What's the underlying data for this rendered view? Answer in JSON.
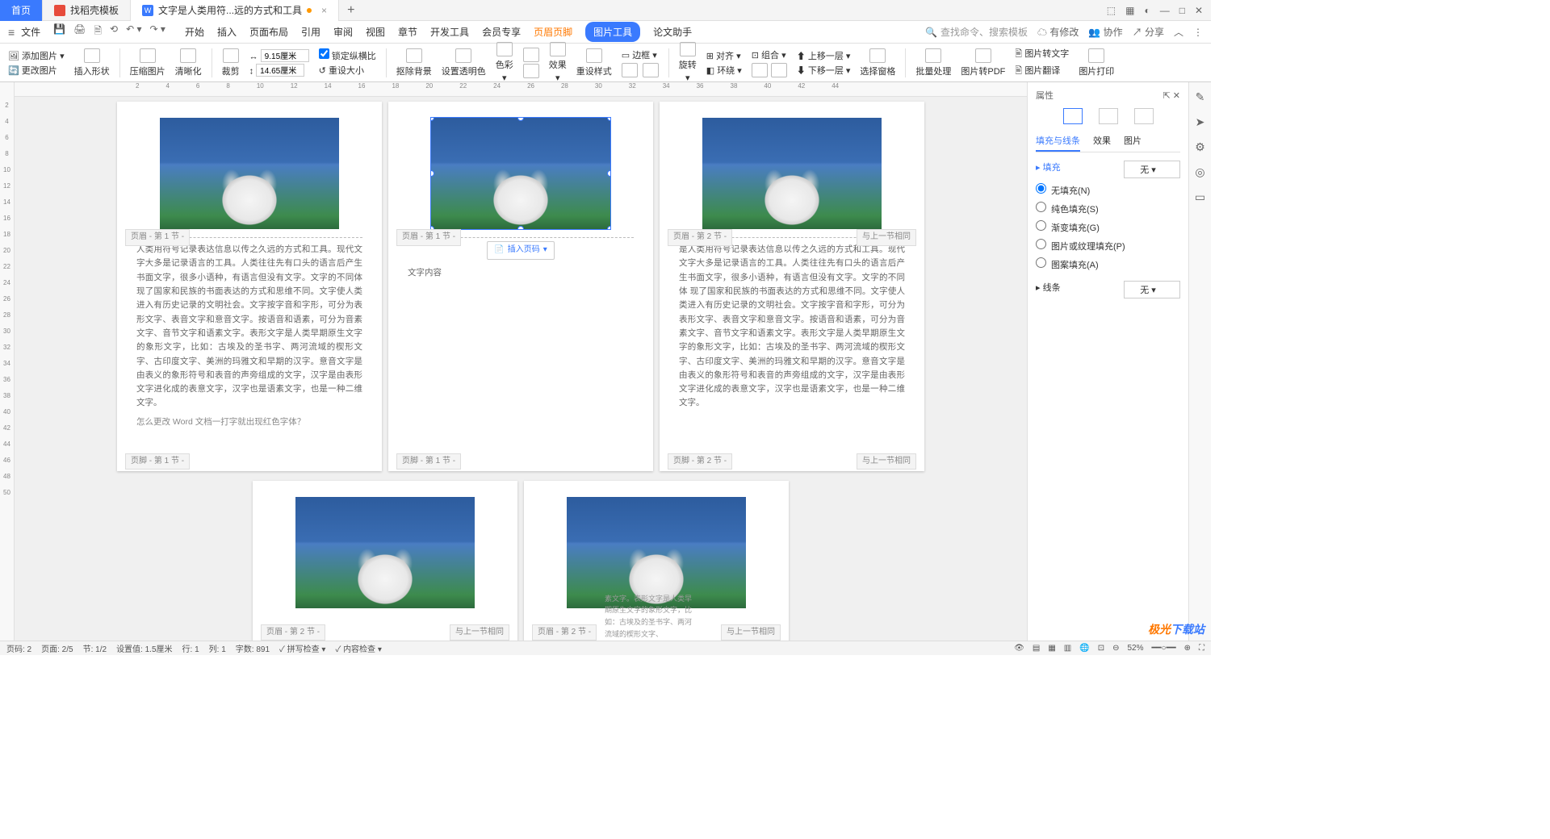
{
  "titlebar": {
    "tabs": [
      {
        "label": "首页"
      },
      {
        "label": "找稻壳模板"
      },
      {
        "label": "文字是人类用符...远的方式和工具"
      }
    ],
    "add": "+",
    "close": "×"
  },
  "menubar": {
    "file": "文件",
    "tabs": [
      "开始",
      "插入",
      "页面布局",
      "引用",
      "审阅",
      "视图",
      "章节",
      "开发工具",
      "会员专享",
      "页眉页脚",
      "图片工具",
      "论文助手"
    ],
    "search_hint": "查找命令、搜索模板",
    "right": {
      "changes": "有修改",
      "collab": "协作",
      "share": "分享"
    }
  },
  "ribbon": {
    "add_pic": "添加图片",
    "change_pic": "更改图片",
    "insert_shape": "插入形状",
    "compress": "压缩图片",
    "sharpen": "清晰化",
    "crop": "裁剪",
    "w": "9.15厘米",
    "h": "14.65厘米",
    "lock": "锁定纵横比",
    "reset": "重设大小",
    "remove_bg": "抠除背景",
    "transparency": "设置透明色",
    "color": "色彩",
    "effect": "效果",
    "reset_style": "重设样式",
    "border": "边框",
    "rotate": "旋转",
    "align": "对齐",
    "wrap": "环绕",
    "group": "组合",
    "up": "上移一层",
    "down": "下移一层",
    "sel_pane": "选择窗格",
    "batch": "批量处理",
    "to_pdf": "图片转PDF",
    "to_text": "图片转文字",
    "translate": "图片翻译",
    "print": "图片打印"
  },
  "ruler_v": [
    "2",
    "4",
    "6",
    "8",
    "10",
    "12",
    "14",
    "16",
    "18",
    "20",
    "22",
    "24",
    "26",
    "28",
    "30",
    "32",
    "34",
    "36",
    "38",
    "40",
    "42",
    "44",
    "46",
    "48",
    "50"
  ],
  "ruler_h": [
    "2",
    "4",
    "6",
    "8",
    "10",
    "12",
    "14",
    "16",
    "18",
    "20",
    "22",
    "24",
    "26",
    "28",
    "30",
    "32",
    "34",
    "36",
    "38",
    "40",
    "42",
    "44"
  ],
  "pages": {
    "p1": {
      "hdr": "页眉 - 第 1 节 -",
      "ftr": "页脚 - 第 1 节 -",
      "body": "人类用符号记录表达信息以传之久远的方式和工具。现代文字大多是记录语言的工具。人类往往先有口头的语言后产生书面文字，很多小语种，有语言但没有文字。文字的不同体 现了国家和民族的书面表达的方式和思维不同。文字使人类进入有历史记录的文明社会。文字按字音和字形，可分为表形文字、表音文字和意音文字。按语音和语素，可分为音素文字、音节文字和语素文字。表形文字是人类早期原生文字的象形文字，比如：古埃及的圣书字、两河流域的楔形文字、古印度文字、美洲的玛雅文和早期的汉字。意音文字是由表义的象形符号和表音的声旁组成的文字，汉字是由表形文字进化成的表意文字，汉字也是语素文字，也是一种二维文字。",
      "note": "怎么更改 Word 文档一打字就出现红色字体？"
    },
    "p2": {
      "hdr": "页眉 - 第 1 节 -",
      "ftr": "页脚 - 第 1 节 -",
      "insert": "插入页码",
      "body": "文字内容"
    },
    "p3": {
      "hdr": "页眉 - 第 2 节 -",
      "hdr_r": "与上一节相同",
      "ftr": "页脚 - 第 2 节 -",
      "ftr_r": "与上一节相同",
      "body": "是人类用符号记录表达信息以传之久远的方式和工具。现代文字大多是记录语言的工具。人类往往先有口头的语言后产生书面文字，很多小语种，有语言但没有文字。文字的不同体 现了国家和民族的书面表达的方式和思维不同。文字使人类进入有历史记录的文明社会。文字按字音和字形，可分为表形文字、表音文字和意音文字。按语音和语素，可分为音素文字、音节文字和语素文字。表形文字是人类早期原生文字的象形文字，比如：古埃及的圣书字、两河流域的楔形文字、古印度文字、美洲的玛雅文和早期的汉字。意音文字是由表义的象形符号和表音的声旁组成的文字，汉字是由表形文字进化成的表意文字，汉字也是语素文字，也是一种二维文字。"
    },
    "p4": {
      "hdr": "页眉 - 第 2 节 -",
      "hdr_r": "与上一节相同"
    },
    "p5": {
      "hdr": "页眉 - 第 2 节 -",
      "hdr_r": "与上一节相同",
      "body": "素文字。表形文字是人类早期原生文字的象形文字，比如：古埃及的圣书字、两河流域的楔形文字、"
    }
  },
  "properties": {
    "title": "属性",
    "tabs": {
      "fill": "填充与线条",
      "effect": "效果",
      "pic": "图片"
    },
    "fill_section": "填充",
    "fill_select": "无",
    "fill_options": [
      "无填充(N)",
      "纯色填充(S)",
      "渐变填充(G)",
      "图片或纹理填充(P)",
      "图案填充(A)"
    ],
    "line_section": "线条",
    "line_select": "无"
  },
  "status": {
    "page_no": "页码: 2",
    "page": "页面: 2/5",
    "section": "节: 1/2",
    "pos": "设置值: 1.5厘米",
    "row": "行: 1",
    "col": "列: 1",
    "words": "字数: 891",
    "spell": "拼写检查",
    "content": "内容检查",
    "zoom": "52%"
  },
  "watermark": {
    "brand": "极光下载站"
  }
}
